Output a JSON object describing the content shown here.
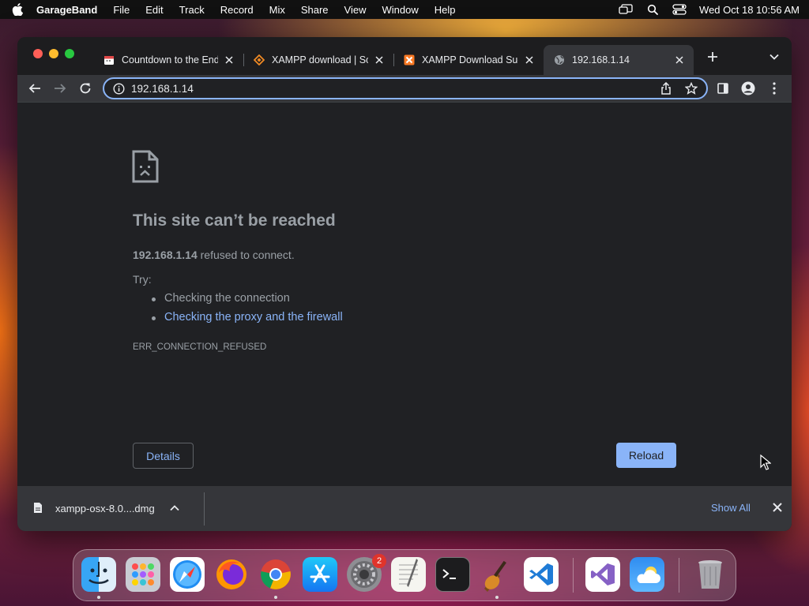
{
  "menubar": {
    "app_name": "GarageBand",
    "items": [
      "File",
      "Edit",
      "Track",
      "Record",
      "Mix",
      "Share",
      "View",
      "Window",
      "Help"
    ],
    "clock": "Wed Oct 18  10:56 AM",
    "status_icons": [
      "screen-mirroring-icon",
      "spotlight-search-icon",
      "control-center-icon"
    ]
  },
  "browser": {
    "tabs": [
      {
        "title": "Countdown to the End",
        "favicon": "countdown-favicon"
      },
      {
        "title": "XAMPP download | So",
        "favicon": "sourceforge-favicon"
      },
      {
        "title": "XAMPP Download Suc",
        "favicon": "xampp-favicon"
      },
      {
        "title": "192.168.1.14",
        "favicon": "globe-favicon",
        "active": true
      }
    ],
    "address": "192.168.1.14",
    "error": {
      "title": "This site can’t be reached",
      "host": "192.168.1.14",
      "desc_suffix": " refused to connect.",
      "try_label": "Try:",
      "suggestions": [
        "Checking the connection",
        "Checking the proxy and the firewall"
      ],
      "code": "ERR_CONNECTION_REFUSED",
      "details_label": "Details",
      "reload_label": "Reload"
    },
    "download": {
      "file_name": "xampp-osx-8.0....dmg",
      "show_all_label": "Show All"
    }
  },
  "dock": {
    "apps": [
      "Finder",
      "Launchpad",
      "Safari",
      "Firefox",
      "Google Chrome",
      "App Store",
      "System Preferences",
      "TextEdit",
      "Terminal",
      "GarageBand",
      "Visual Studio Code",
      "Visual Studio",
      "Weather",
      "Trash"
    ],
    "system_preferences_badge": "2"
  },
  "colors": {
    "accent": "#8ab4f8",
    "window_bg": "#202124",
    "toolbar_bg": "#35363a",
    "text_muted": "#9aa0a6"
  }
}
